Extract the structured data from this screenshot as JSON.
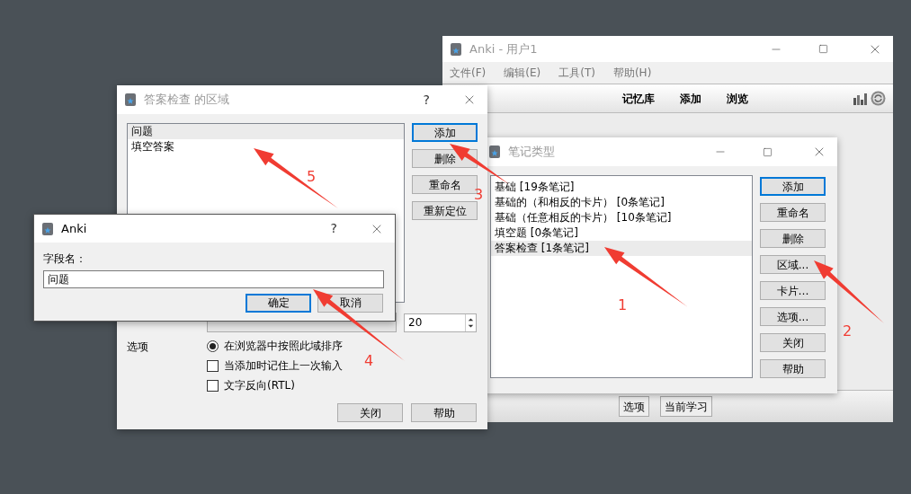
{
  "main_window": {
    "title": "Anki - 用户1",
    "menu": [
      "文件(F)",
      "编辑(E)",
      "工具(T)",
      "帮助(H)"
    ],
    "toolbar": [
      "记忆库",
      "添加",
      "浏览"
    ],
    "bottom_buttons": [
      "选项",
      "当前学习"
    ]
  },
  "note_types_dialog": {
    "title": "笔记类型",
    "items": [
      {
        "label": "基础 [19条笔记]",
        "selected": false
      },
      {
        "label": "基础的（和相反的卡片） [0条笔记]",
        "selected": false
      },
      {
        "label": "基础（任意相反的卡片） [10条笔记]",
        "selected": false
      },
      {
        "label": "填空题 [0条笔记]",
        "selected": false
      },
      {
        "label": "答案检查 [1条笔记]",
        "selected": true
      }
    ],
    "buttons": [
      {
        "label": "添加",
        "default": true
      },
      {
        "label": "重命名",
        "default": false
      },
      {
        "label": "删除",
        "default": false
      },
      {
        "label": "区域...",
        "default": false
      },
      {
        "label": "卡片…",
        "default": false
      },
      {
        "label": "选项...",
        "default": false
      },
      {
        "label": "关闭",
        "default": false
      },
      {
        "label": "帮助",
        "default": false
      }
    ]
  },
  "fields_dialog": {
    "title": "答案检查 的区域",
    "help": "?",
    "fields": [
      {
        "label": "问题",
        "selected": true
      },
      {
        "label": "填空答案",
        "selected": false
      }
    ],
    "buttons": [
      {
        "label": "添加",
        "default": true
      },
      {
        "label": "删除",
        "default": false
      },
      {
        "label": "重命名",
        "default": false
      },
      {
        "label": "重新定位",
        "default": false
      }
    ],
    "font_size": "20",
    "options_label": "选项",
    "options": [
      {
        "kind": "radio",
        "label": "在浏览器中按照此域排序",
        "checked": true
      },
      {
        "kind": "checkbox",
        "label": "当添加时记住上一次输入",
        "checked": false
      },
      {
        "kind": "checkbox",
        "label": "文字反向(RTL)",
        "checked": false
      }
    ],
    "footer_buttons": [
      "关闭",
      "帮助"
    ]
  },
  "prompt_dialog": {
    "title": "Anki",
    "help": "?",
    "label": "字段名：",
    "value": "问题",
    "buttons": [
      {
        "label": "确定",
        "default": true
      },
      {
        "label": "取消",
        "default": false
      }
    ]
  },
  "annotations": [
    {
      "label": "1"
    },
    {
      "label": "2"
    },
    {
      "label": "3"
    },
    {
      "label": "4"
    },
    {
      "label": "5"
    }
  ]
}
